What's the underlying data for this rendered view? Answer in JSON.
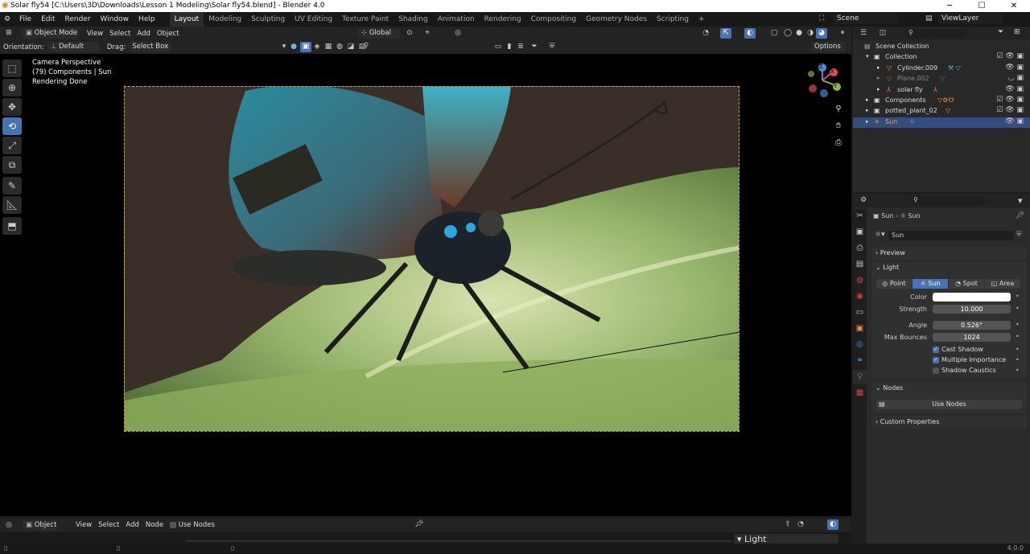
{
  "window": {
    "title": "Solar fly54 [C:\\Users\\3D\\Downloads\\Lesson 1 Modeling\\Solar fly54.blend] - Blender 4.0",
    "min": "─",
    "max": "☐",
    "close": "✕"
  },
  "menubar": {
    "items": [
      "File",
      "Edit",
      "Render",
      "Window",
      "Help"
    ],
    "workspaces": [
      "Layout",
      "Modeling",
      "Sculpting",
      "UV Editing",
      "Texture Paint",
      "Shading",
      "Animation",
      "Rendering",
      "Compositing",
      "Geometry Nodes",
      "Scripting"
    ],
    "active_workspace": "Layout",
    "add_tab": "+",
    "scene": "Scene",
    "view_layer": "ViewLayer"
  },
  "viewport_header": {
    "mode": "Object Mode",
    "menus": [
      "View",
      "Select",
      "Add",
      "Object"
    ],
    "transform": "Global",
    "orientation_label": "Orientation:",
    "orientation": "Default",
    "drag_label": "Drag:",
    "drag": "Select Box",
    "options": "Options"
  },
  "viewport": {
    "line1": "Camera Perspective",
    "line2": "(79) Components | Sun",
    "line3": "Rendering Done"
  },
  "nav_gizmo": {
    "z": "Z",
    "y": "Y",
    "x": "X"
  },
  "bottom_header": {
    "editor": "Object",
    "menus": [
      "View",
      "Select",
      "Add",
      "Node"
    ],
    "use_nodes": "Use Nodes",
    "light_panel": "Light"
  },
  "status": {
    "version": "4.0.0"
  },
  "outliner": {
    "rows": [
      {
        "name": "Scene Collection",
        "indent": 0
      },
      {
        "name": "Collection",
        "indent": 1
      },
      {
        "name": "Cylinder.009",
        "indent": 2
      },
      {
        "name": "Plane.002",
        "indent": 2
      },
      {
        "name": "solar fly",
        "indent": 2
      },
      {
        "name": "Components",
        "indent": 1
      },
      {
        "name": "potted_plant_02",
        "indent": 1
      },
      {
        "name": "Sun",
        "indent": 1
      }
    ],
    "selected": "Sun"
  },
  "properties": {
    "breadcrumb_obj": "Sun",
    "breadcrumb_data": "Sun",
    "datablock": "Sun",
    "preview": "Preview",
    "light": "Light",
    "types": [
      "Point",
      "Sun",
      "Spot",
      "Area"
    ],
    "active_type": "Sun",
    "color_label": "Color",
    "color": "#ffffff",
    "strength_label": "Strength",
    "strength": "10.000",
    "angle_label": "Angle",
    "angle": "0.526°",
    "bounces_label": "Max Bounces",
    "bounces": "1024",
    "cast_shadow": "Cast Shadow",
    "multiple_importance": "Multiple Importance",
    "shadow_caustics": "Shadow Caustics",
    "nodes": "Nodes",
    "use_nodes_btn": "Use Nodes",
    "custom_props": "Custom Properties"
  }
}
